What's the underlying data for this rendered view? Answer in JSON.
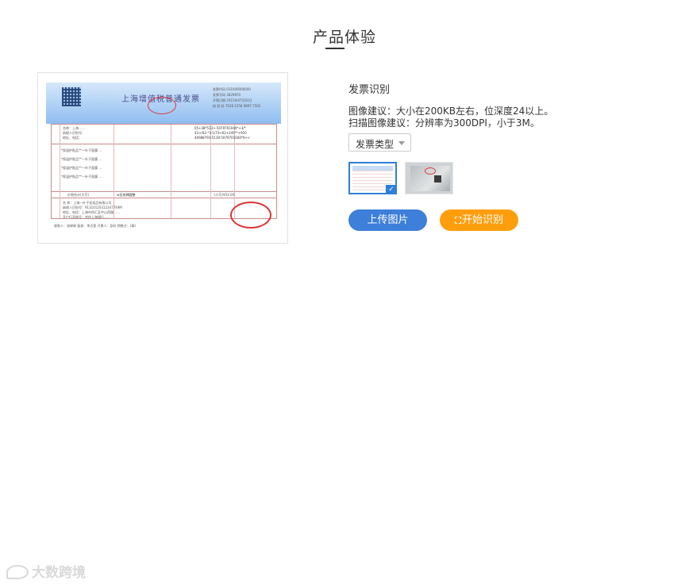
{
  "page": {
    "title": "产品体验"
  },
  "preview": {
    "invoice_title": "上海增值税普通发票",
    "invoice_meta": [
      "发票代码 031000000000",
      "发票号码 3829870",
      "开票日期 2015年07月02日",
      "校 验 码 7028 1558 9897 7502"
    ],
    "buyer_lines": [
      "名称：上海……",
      "纳税人识别号：",
      "地址、电话：",
      "开户行及账号："
    ],
    "cipher": [
      "05+38*513>-5079701040*+3/*",
      "43>/02-*3-1/73+62+245**+910",
      "40988793-5130-5079701040*9+<"
    ],
    "items": [
      "*保温护贴品**一叶子面膜 …",
      "*保温护贴品**一叶子面膜 …",
      "*保温护贴品**一叶子面膜 …",
      "*保温护贴品**一叶子面膜 …"
    ],
    "total_label": "价税合计(大写)",
    "total_value": "⊗伍拾肆圆整",
    "total_small": "(小写)¥54.00",
    "seller_lines": [
      "名 称：上海一叶子化妆品有限公司",
      "纳税人识别号：91310120312347749M",
      "地址、电话：上海市徐汇区中山西路……",
      "开户行及账号：合作上海银行……"
    ],
    "sign_row": "收款人：张婷婷     复核：李点莲     开票人：彭虹     销售方：(章)"
  },
  "panel": {
    "title": "发票识别",
    "tip1": "图像建议：大小在200KB左右，位深度24以上。",
    "tip2": "扫描图像建议：分辨率为300DPI，小于3M。",
    "select_value": "发票类型",
    "thumb_check": "✓",
    "upload_button": "上传图片",
    "start_button": "开始识别"
  },
  "watermark": {
    "text": "大数跨境"
  },
  "colors": {
    "primary_blue": "#3d7fd9",
    "accent_orange": "#ff9e0d",
    "selected_border": "#2f7ed8"
  }
}
